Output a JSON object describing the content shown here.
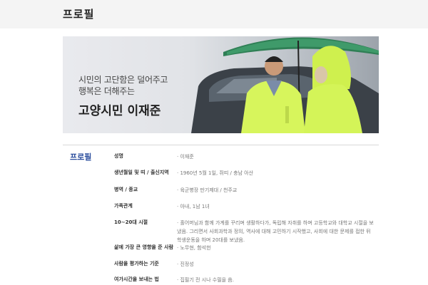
{
  "page": {
    "title": "프로필"
  },
  "hero": {
    "line1": "시민의 고단함은 덜어주고",
    "line2": "행복은 더해주는",
    "name": "고양시민 이재준"
  },
  "profile": {
    "section_title": "프로필",
    "rows": [
      {
        "label": "성명",
        "value": "· 이재준"
      },
      {
        "label": "생년월일 및 띠 / 출신지역",
        "value": "· 1960년 5월 1일, 쥐띠 / 충남 아산"
      },
      {
        "label": "병역 / 종교",
        "value": "· 육군병장 만기제대 / 천주교"
      },
      {
        "label": "가족관계",
        "value": "· 아내, 1남 1녀"
      },
      {
        "label": "10~20대 시절",
        "value": "· 홀어머님과 함께 가계를 꾸리며 생활하다가, 독립해 자취를 하며 고등학교와 대학교 시절을 보냈음. 그리면서 사회과학과 정의, 역사에 대해 고민하기 시작했고, 사회에 대한 문제를 접한 뒤 학생운동을 하며 20대를 보냈음."
      },
      {
        "label": "삶에 가장 큰 영향을 준 사람",
        "value": "· 노무현, 함석헌"
      },
      {
        "label": "사람을 평가하는 기준",
        "value": "· 진정성"
      },
      {
        "label": "여가시간을 보내는 법",
        "value": "· 집필기 전 시나 수필을 씀."
      }
    ]
  }
}
